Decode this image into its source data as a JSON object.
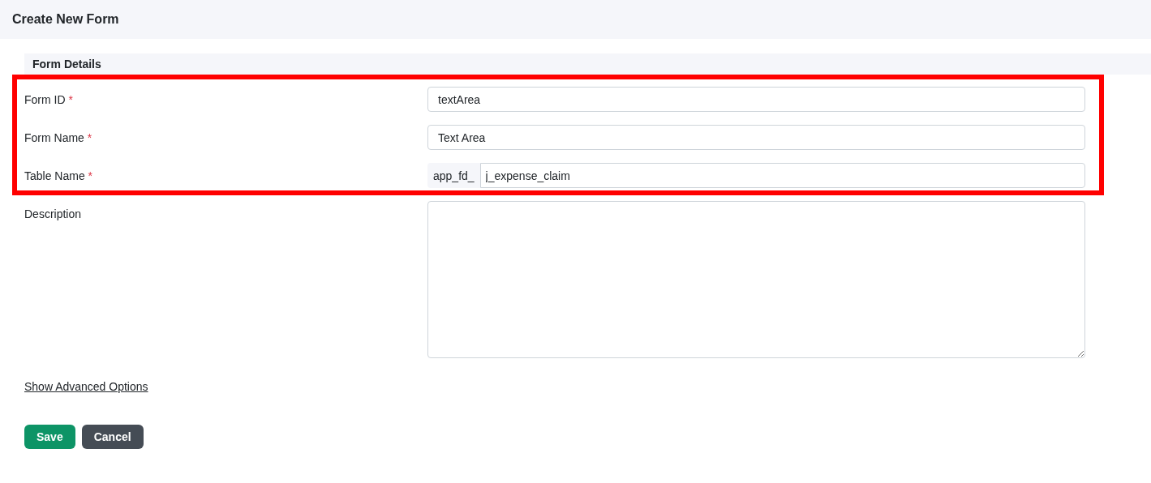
{
  "page_title": "Create New Form",
  "section_title": "Form Details",
  "fields": [
    {
      "kind": "text",
      "label": "Form ID",
      "required_mark": "*",
      "highlighted": true,
      "value": "textArea"
    },
    {
      "kind": "text",
      "label": "Form Name",
      "required_mark": "*",
      "highlighted": true,
      "value": "Text Area"
    },
    {
      "kind": "prefixed",
      "label": "Table Name",
      "required_mark": "*",
      "highlighted": true,
      "prefix": "app_fd_",
      "value": "j_expense_claim"
    },
    {
      "kind": "textarea",
      "label": "Description",
      "highlighted": false
    }
  ],
  "advanced_link": "Show Advanced Options",
  "buttons": [
    {
      "kind": "primary",
      "label": "Save"
    },
    {
      "kind": "secondary",
      "label": "Cancel"
    }
  ]
}
